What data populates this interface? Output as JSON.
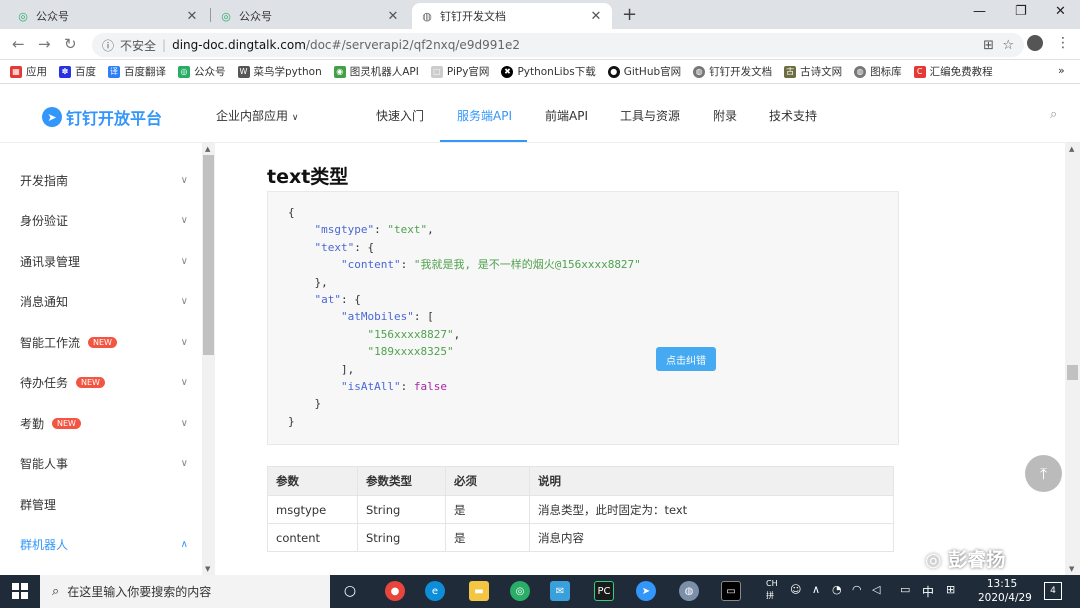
{
  "browser": {
    "tabs": [
      {
        "title": "公众号"
      },
      {
        "title": "公众号"
      },
      {
        "title": "钉钉开发文档"
      }
    ],
    "address": {
      "insecure": "不安全",
      "host": "ding-doc.dingtalk.com",
      "path": "/doc#/serverapi2/qf2nxq/e9d991e2"
    },
    "bookmarks": [
      "应用",
      "百度",
      "百度翻译",
      "公众号",
      "菜鸟学python",
      "图灵机器人API",
      "PiPy官网",
      "PythonLibs下载",
      "GitHub官网",
      "钉钉开发文档",
      "古诗文网",
      "图标库",
      "汇编免费教程"
    ]
  },
  "site": {
    "logo": "钉钉开放平台",
    "nav": [
      "企业内部应用",
      "快速入门",
      "服务端API",
      "前端API",
      "工具与资源",
      "附录",
      "技术支持"
    ],
    "active_nav": "服务端API"
  },
  "sidebar": {
    "items": [
      {
        "label": "开发指南",
        "badge": ""
      },
      {
        "label": "身份验证",
        "badge": ""
      },
      {
        "label": "通讯录管理",
        "badge": ""
      },
      {
        "label": "消息通知",
        "badge": ""
      },
      {
        "label": "智能工作流",
        "badge": "NEW"
      },
      {
        "label": "待办任务",
        "badge": "NEW"
      },
      {
        "label": "考勤",
        "badge": "NEW"
      },
      {
        "label": "智能人事",
        "badge": ""
      },
      {
        "label": "群管理",
        "badge": ""
      },
      {
        "label": "群机器人",
        "badge": ""
      }
    ]
  },
  "content": {
    "heading": "text类型",
    "code": {
      "brace_open": "{",
      "brace_close": "}",
      "msgtype_key": "\"msgtype\"",
      "msgtype_val": "\"text\"",
      "text_key": "\"text\"",
      "content_key": "\"content\"",
      "content_val": "\"我就是我, 是不一样的烟火@156xxxx8827\"",
      "at_key": "\"at\"",
      "atMobiles_key": "\"atMobiles\"",
      "mobile1": "\"156xxxx8827\"",
      "mobile2": "\"189xxxx8325\"",
      "isAtAll_key": "\"isAtAll\"",
      "isAtAll_val": "false"
    },
    "correct_button": "点击纠错",
    "table": {
      "headers": [
        "参数",
        "参数类型",
        "必须",
        "说明"
      ],
      "rows": [
        [
          "msgtype",
          "String",
          "是",
          "消息类型，此时固定为：text"
        ],
        [
          "content",
          "String",
          "是",
          "消息内容"
        ]
      ]
    }
  },
  "watermark": "彭睿扬",
  "taskbar": {
    "search_placeholder": "在这里输入你要搜索的内容",
    "ime_ch": "CH",
    "ime_pin": "拼",
    "lang": "中",
    "time": "13:15",
    "date": "2020/4/29",
    "notifications": "4"
  }
}
